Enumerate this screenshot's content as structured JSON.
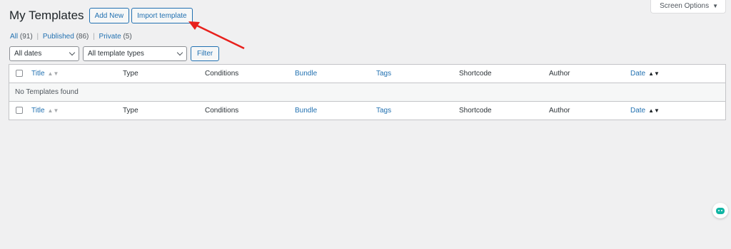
{
  "header": {
    "title": "My Templates",
    "add_new_label": "Add New",
    "import_label": "Import template",
    "screen_options_label": "Screen Options"
  },
  "views": [
    {
      "label": "All",
      "count": "(91)"
    },
    {
      "label": "Published",
      "count": "(86)"
    },
    {
      "label": "Private",
      "count": "(5)"
    }
  ],
  "filters": {
    "dates_selected": "All dates",
    "types_selected": "All template types",
    "filter_label": "Filter"
  },
  "table": {
    "columns": [
      "Title",
      "Type",
      "Conditions",
      "Bundle",
      "Tags",
      "Shortcode",
      "Author",
      "Date"
    ],
    "empty_message": "No Templates found"
  },
  "colors": {
    "accent": "#2271b1",
    "annotation_arrow": "#e8201c",
    "chat_widget": "#11b5a4"
  }
}
